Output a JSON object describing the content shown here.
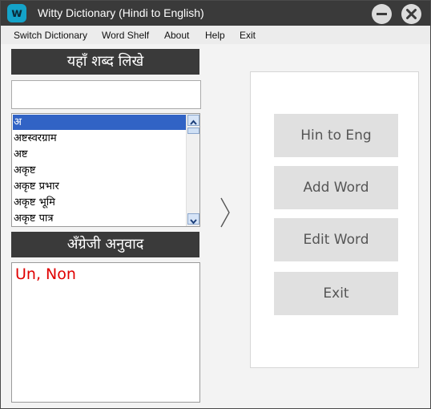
{
  "window": {
    "title": "Witty Dictionary (Hindi to English)",
    "logo_letter": "w",
    "logo_color": "#14a3c9",
    "titlebar_color": "#3a3a3a"
  },
  "menu": {
    "items": [
      "Switch Dictionary",
      "Word Shelf",
      "About",
      "Help",
      "Exit"
    ]
  },
  "search": {
    "header": "यहाँ शब्द लिखे",
    "value": "",
    "placeholder": ""
  },
  "word_list": {
    "items": [
      "अ",
      "अष्टस्वरग्राम",
      "अष्ट",
      "अकृष्ट",
      "अकृष्ट प्रभार",
      "अकृष्ट भूमि",
      "अकृष्ट पात्र"
    ],
    "selected_index": 0,
    "selection_color": "#3163c5"
  },
  "translation": {
    "header": "अँग्रेजी अनुवाद",
    "text": "Un, Non",
    "text_color": "#e00000"
  },
  "actions": {
    "buttons": [
      "Hin to Eng",
      "Add Word",
      "Edit Word",
      "Exit"
    ]
  },
  "icons": {
    "logo": "witty-logo-icon",
    "minimize": "minimize-icon",
    "close": "close-icon",
    "chevron": "chevron-right-icon",
    "scroll_up": "scroll-up-arrow-icon",
    "scroll_down": "scroll-down-arrow-icon"
  }
}
